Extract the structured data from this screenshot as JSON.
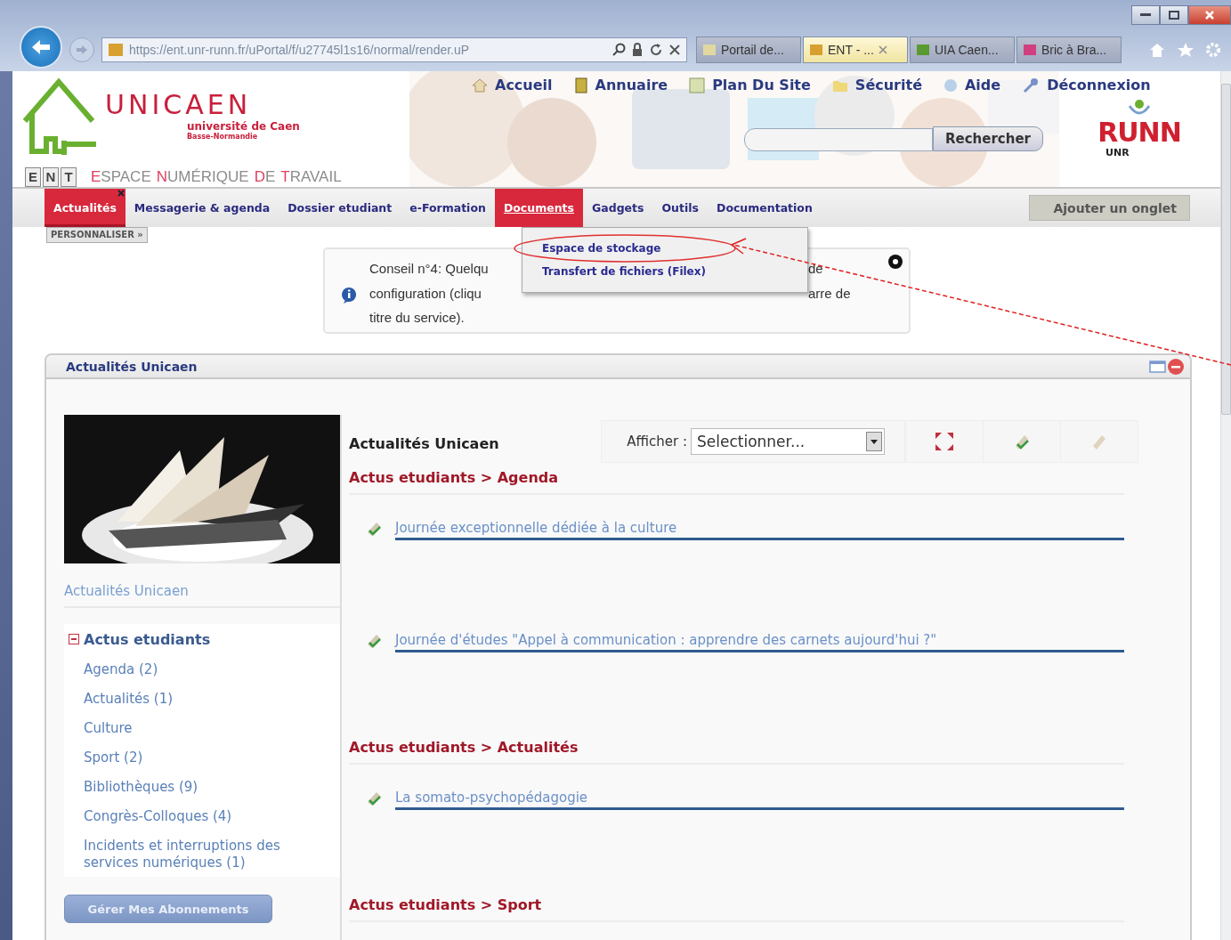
{
  "browser": {
    "url": "https://ent.unr-runn.fr/uPortal/f/u27745l1s16/normal/render.uP",
    "tabs": [
      {
        "label": "Portail de...",
        "selected": false
      },
      {
        "label": "ENT - ...",
        "selected": true
      },
      {
        "label": "UIA Caen...",
        "selected": false
      },
      {
        "label": "Bric à Bra...",
        "selected": false
      }
    ]
  },
  "header": {
    "logo": {
      "name": "UNICAEN",
      "university": "université de Caen",
      "region": "Basse-Normandie",
      "letters": [
        "E",
        "N",
        "T"
      ],
      "tagline": [
        "ESPACE",
        "NUMÉRIQUE",
        "DE",
        "TRAVAIL"
      ]
    },
    "links": [
      "Accueil",
      "Annuaire",
      "Plan Du Site",
      "Sécurité",
      "Aide",
      "Déconnexion"
    ],
    "search_button": "Rechercher",
    "partner_logo": {
      "mark": "RUNN",
      "caption": "UNR"
    }
  },
  "nav": {
    "tabs": [
      {
        "label": "Actualités",
        "selected": true,
        "menu_open": false,
        "closable": true
      },
      {
        "label": "Messagerie & agenda",
        "selected": false,
        "menu_open": false,
        "closable": false
      },
      {
        "label": "Dossier etudiant",
        "selected": false,
        "menu_open": false,
        "closable": false
      },
      {
        "label": "e-Formation",
        "selected": false,
        "menu_open": false,
        "closable": false
      },
      {
        "label": "Documents",
        "selected": false,
        "menu_open": true,
        "closable": false
      },
      {
        "label": "Gadgets",
        "selected": false,
        "menu_open": false,
        "closable": false
      },
      {
        "label": "Outils",
        "selected": false,
        "menu_open": false,
        "closable": false
      },
      {
        "label": "Documentation",
        "selected": false,
        "menu_open": false,
        "closable": false
      }
    ],
    "menu": [
      "Espace de stockage",
      "Transfert de fichiers (Filex)"
    ],
    "add_tab": "Ajouter un onglet",
    "customize": "PERSONNALISER »"
  },
  "tip": {
    "lines": [
      {
        "left": "Conseil n°4: Quelqu",
        "right": "de"
      },
      {
        "left": "configuration (cliqu",
        "right": "arre de"
      },
      {
        "left": "titre du service)."
      }
    ]
  },
  "portlet": {
    "title": "Actualités Unicaen",
    "sidebar": {
      "link": "Actualités Unicaen",
      "tree": [
        {
          "label": "Actus etudiants",
          "expanded": true,
          "children": [
            {
              "label": "Agenda (2)"
            },
            {
              "label": "Actualités (1)"
            },
            {
              "label": "Culture"
            },
            {
              "label": "Sport (2)"
            },
            {
              "label": "Bibliothèques (9)"
            },
            {
              "label": "Congrès-Colloques (4)"
            },
            {
              "label": "Incidents et interruptions des services numériques (1)"
            }
          ]
        }
      ],
      "button": "Gérer Mes Abonnements"
    },
    "main": {
      "title": "Actualités Unicaen",
      "filter": {
        "label": "Afficher :",
        "value": "Selectionner..."
      },
      "sections": [
        {
          "heading": "Actus etudiants > Agenda",
          "items": [
            "Journée exceptionnelle dédiée à la culture",
            "Journée d'études \"Appel à communication : apprendre des carnets aujourd'hui ?\""
          ]
        },
        {
          "heading": "Actus etudiants > Actualités",
          "items": [
            "La somato-psychopédagogie"
          ]
        },
        {
          "heading": "Actus etudiants > Sport"
        }
      ]
    }
  }
}
